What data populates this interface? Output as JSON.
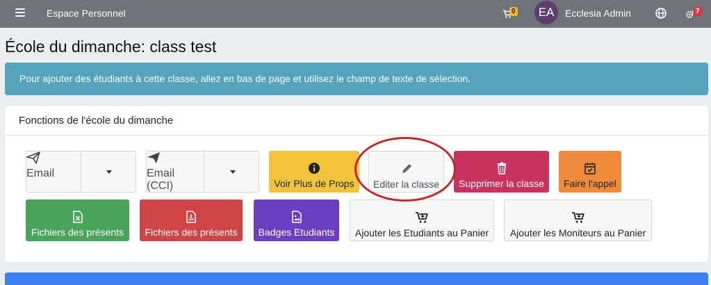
{
  "topbar": {
    "brand": "Espace Personnel",
    "cart_count": "0",
    "avatar_initials": "EA",
    "username": "Ecclesia Admin",
    "notif_count": "7"
  },
  "page": {
    "title": "École du dimanche: class test",
    "alert": "Pour ajouter des étudiants à cette classe, allez en bas de page et utilisez le champ de texte de sélection."
  },
  "card": {
    "header": "Fonctions de l'école du dimanche",
    "buttons": {
      "email": "Email",
      "email_cci": "Email (CCI)",
      "props": "Voir Plus de Props",
      "edit": "Editer la classe",
      "delete": "Supprimer la classe",
      "attendance": "Faire l'appel",
      "attendees_excel": "Fichiers des présents",
      "attendees_pdf": "Fichiers des présents",
      "badges": "Badges Etudiants",
      "add_students_cart": "Ajouter les Etudiants au Panier",
      "add_monitors_cart": "Ajouter les Moniteurs au Panier"
    }
  },
  "colors": {
    "topbar": "#6f7377",
    "alert": "#53a4bc",
    "warning": "#f4c33c",
    "danger_pink": "#c9325e",
    "orange": "#ef8b3a",
    "success": "#4aa35b",
    "danger": "#d04445",
    "purple": "#6c3fc2",
    "primary": "#3b82f0"
  },
  "icons": {
    "menu": "menu-icon",
    "cart": "cart-icon",
    "globe": "globe-icon",
    "settings": "gears-icon"
  }
}
